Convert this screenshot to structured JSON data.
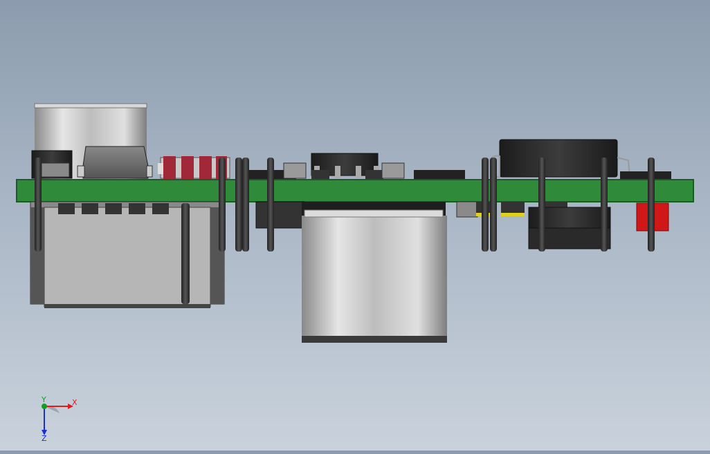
{
  "viewport": {
    "background_top": "#8c9cae",
    "background_bottom": "#c9d2dc",
    "model": "pcb-assembly-side-view"
  },
  "colors": {
    "pcb_green": "#2f8a3a",
    "pcb_edge": "#1c5a24",
    "metal": "#c8c8c8",
    "black_part": "#2a2a2a",
    "red_part": "#d01818",
    "yellow_band": "#e0d020",
    "resistor_red": "#a02838"
  },
  "triad": {
    "x_label": "X",
    "y_label": "Y",
    "z_label": "Z",
    "x_color": "#e01b1b",
    "y_color": "#10a020",
    "z_color": "#1a2fd6"
  }
}
